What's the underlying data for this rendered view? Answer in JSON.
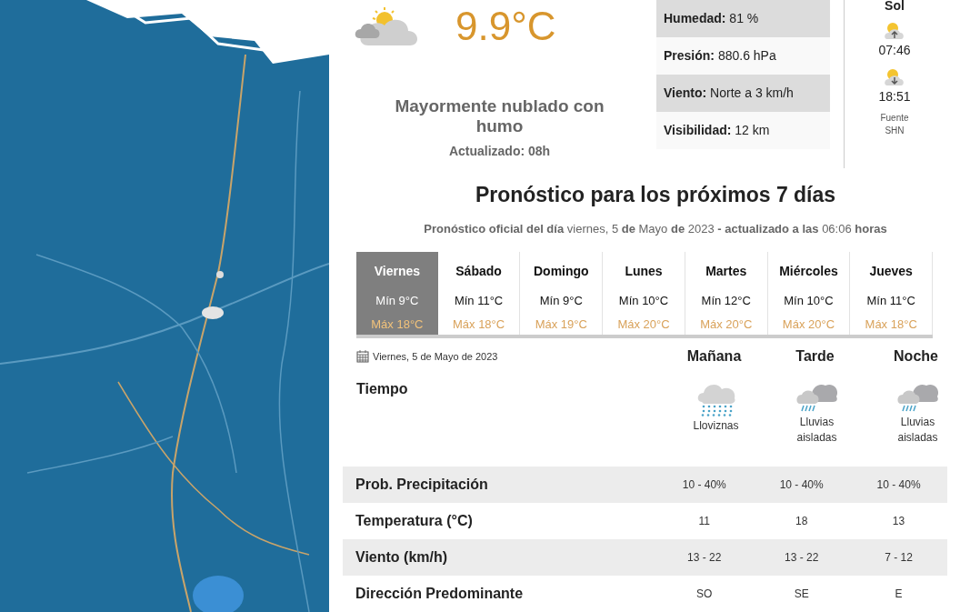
{
  "current": {
    "temperature": "9.9°C",
    "description": "Mayormente nublado con humo",
    "updated": "Actualizado: 08h"
  },
  "details": [
    {
      "label": "Humedad:",
      "value": "81 %"
    },
    {
      "label": "Presión:",
      "value": "880.6 hPa"
    },
    {
      "label": "Viento:",
      "value": "Norte a 3 km/h"
    },
    {
      "label": "Visibilidad:",
      "value": "12 km"
    }
  ],
  "sun": {
    "title": "Sol",
    "sunrise": "07:46",
    "sunset": "18:51",
    "source": [
      "Fuente",
      "SHN"
    ]
  },
  "forecast": {
    "title": "Pronóstico para los próximos 7 días",
    "subtitle": "**Pronóstico oficial del día** viernes, 5 **de** Mayo **de** 2023 **- actualizado a las** 06:06 **horas**",
    "days": [
      {
        "name": "Viernes",
        "min": "Mín 9°C",
        "max": "Máx 18°C",
        "selected": true
      },
      {
        "name": "Sábado",
        "min": "Mín 11°C",
        "max": "Máx 18°C",
        "selected": false
      },
      {
        "name": "Domingo",
        "min": "Mín 9°C",
        "max": "Máx 19°C",
        "selected": false
      },
      {
        "name": "Lunes",
        "min": "Mín 10°C",
        "max": "Máx 20°C",
        "selected": false
      },
      {
        "name": "Martes",
        "min": "Mín 12°C",
        "max": "Máx 20°C",
        "selected": false
      },
      {
        "name": "Miércoles",
        "min": "Mín 10°C",
        "max": "Máx 20°C",
        "selected": false
      },
      {
        "name": "Jueves",
        "min": "Mín 11°C",
        "max": "Máx 18°C",
        "selected": false
      }
    ]
  },
  "detail_table": {
    "date": "Viernes, 5 de Mayo de 2023",
    "periods": [
      "Mañana",
      "Tarde",
      "Noche"
    ],
    "weather_label": "Tiempo",
    "weather": [
      {
        "kind": "drizzle",
        "text": "Lloviznas"
      },
      {
        "kind": "rain",
        "text": "Lluvias aisladas"
      },
      {
        "kind": "rain",
        "text": "Lluvias aisladas"
      }
    ],
    "rows": [
      {
        "label": "Prob. Precipitación",
        "values": [
          "10 - 40%",
          "10 - 40%",
          "10 - 40%"
        ]
      },
      {
        "label": "Temperatura (°C)",
        "values": [
          "11",
          "18",
          "13"
        ]
      },
      {
        "label": "Viento (km/h)",
        "values": [
          "13 - 22",
          "13 - 22",
          "7 - 12"
        ]
      },
      {
        "label": "Dirección Predominante",
        "values": [
          "SO",
          "SE",
          "E"
        ]
      }
    ]
  }
}
